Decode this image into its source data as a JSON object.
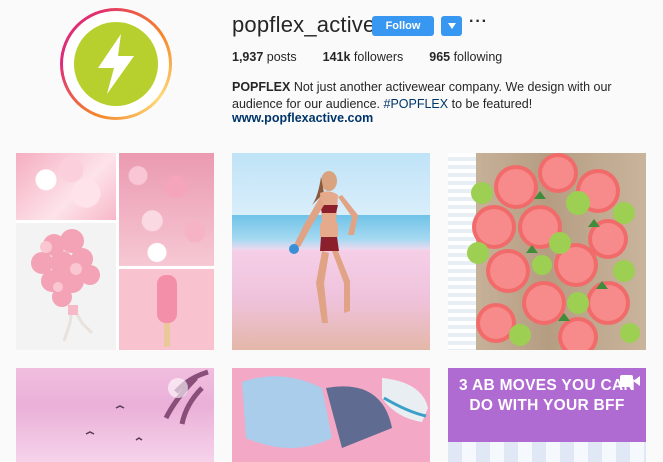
{
  "profile": {
    "username": "popflex_active",
    "follow_label": "Follow",
    "more_label": "···",
    "stats": {
      "posts_count": "1,937",
      "posts_label": " posts",
      "followers_count": "141k",
      "followers_label": " followers",
      "following_count": "965",
      "following_label": " following"
    },
    "bio": {
      "name": "POPFLEX",
      "text_1": " Not just another activewear company. We design with our audience for our audience. ",
      "hashtag": "#POPFLEX",
      "text_2": " to be featured!"
    },
    "website": "www.popflexactive.com"
  },
  "colors": {
    "accent": "#3897f0",
    "link": "#003569",
    "logo_green": "#b8d02e"
  },
  "posts": [
    {
      "label": "collage"
    },
    {
      "label": "beach-runner"
    },
    {
      "label": "grapefruit"
    },
    {
      "label": "pink-sky"
    },
    {
      "label": "bag-sneaker"
    },
    {
      "label": "video",
      "caption_line1": "3 AB MOVES YOU CAN",
      "caption_line2": "DO WITH YOUR BFF"
    }
  ]
}
